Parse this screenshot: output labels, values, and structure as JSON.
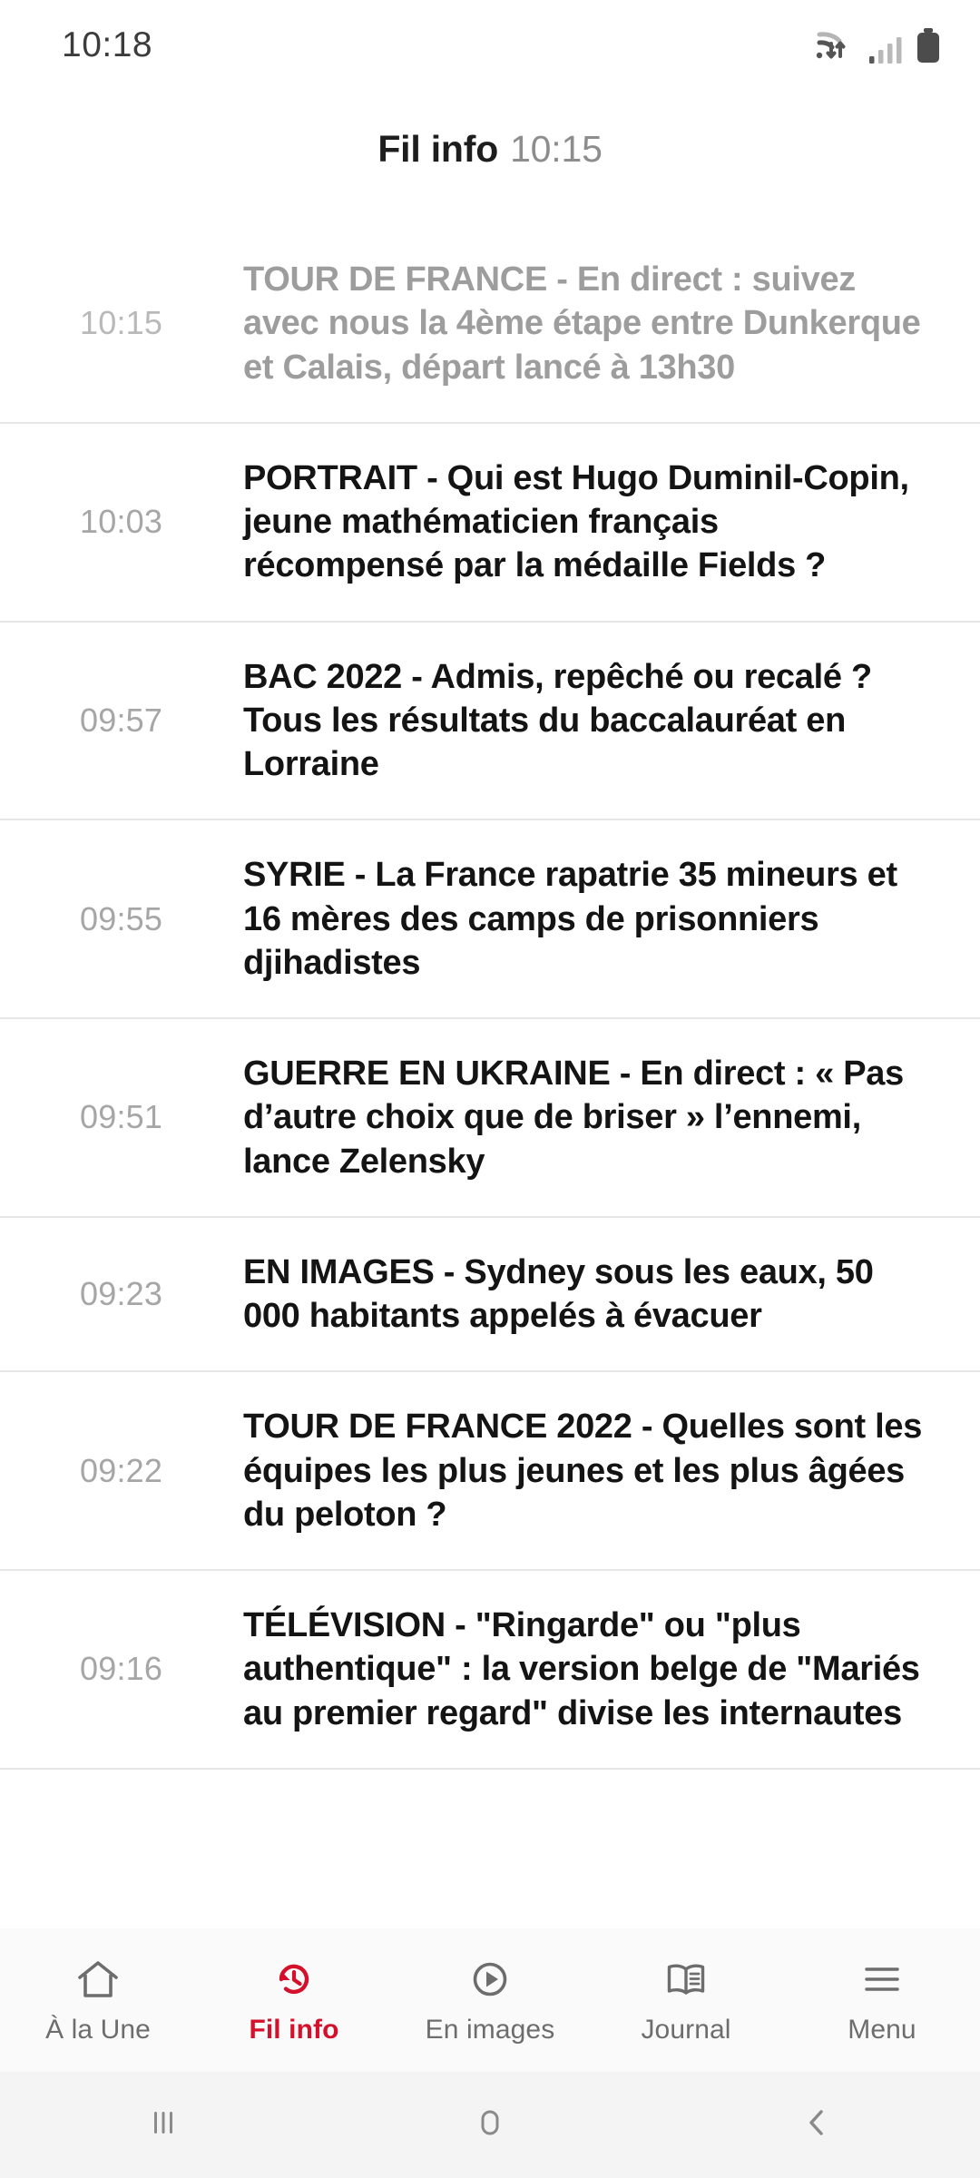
{
  "status_bar": {
    "clock": "10:18",
    "icons": [
      "wifi-transfer-icon",
      "cellular-signal-icon",
      "battery-icon"
    ]
  },
  "header": {
    "title": "Fil info",
    "time": "10:15"
  },
  "colors": {
    "accent_red": "#d4102a",
    "headline": "#141414",
    "read_headline": "#9d9d9d",
    "timestamp": "#a6a6a6",
    "divider": "#e6e6e6",
    "tabbar_bg": "#fafafa",
    "sysnav_bg": "#f4f4f4"
  },
  "feed": {
    "items": [
      {
        "time": "10:15",
        "headline": "TOUR DE FRANCE - En direct : suivez avec nous la 4ème étape entre Dunkerque et Calais, départ lancé à 13h30",
        "read": true
      },
      {
        "time": "10:03",
        "headline": "PORTRAIT - Qui est Hugo Duminil-Copin, jeune mathématicien français récompensé par la médaille Fields ?",
        "read": false
      },
      {
        "time": "09:57",
        "headline": "BAC 2022 - Admis, repêché ou recalé ? Tous les résultats du baccalauréat en Lorraine",
        "read": false
      },
      {
        "time": "09:55",
        "headline": "SYRIE - La France rapatrie 35 mineurs et 16 mères des camps de prisonniers djihadistes",
        "read": false
      },
      {
        "time": "09:51",
        "headline": "GUERRE EN UKRAINE - En direct : « Pas d’autre choix que de briser » l’ennemi, lance Zelensky",
        "read": false
      },
      {
        "time": "09:23",
        "headline": "EN IMAGES - Sydney sous les eaux, 50 000 habitants appelés à évacuer",
        "read": false
      },
      {
        "time": "09:22",
        "headline": "TOUR DE FRANCE 2022 - Quelles sont les équipes les plus jeunes et les plus âgées du peloton ?",
        "read": false
      },
      {
        "time": "09:16",
        "headline": "TÉLÉVISION - \"Ringarde\" ou \"plus authentique\" : la version belge de \"Mariés au premier regard\" divise les internautes",
        "read": false
      }
    ]
  },
  "tabbar": {
    "tabs": [
      {
        "label": "À la Une",
        "icon": "home-icon",
        "active": false
      },
      {
        "label": "Fil info",
        "icon": "history-icon",
        "active": true
      },
      {
        "label": "En images",
        "icon": "play-circle-icon",
        "active": false
      },
      {
        "label": "Journal",
        "icon": "book-icon",
        "active": false
      },
      {
        "label": "Menu",
        "icon": "hamburger-icon",
        "active": false
      }
    ]
  },
  "system_nav": {
    "buttons": [
      {
        "name": "recents-button"
      },
      {
        "name": "home-button"
      },
      {
        "name": "back-button"
      }
    ]
  }
}
